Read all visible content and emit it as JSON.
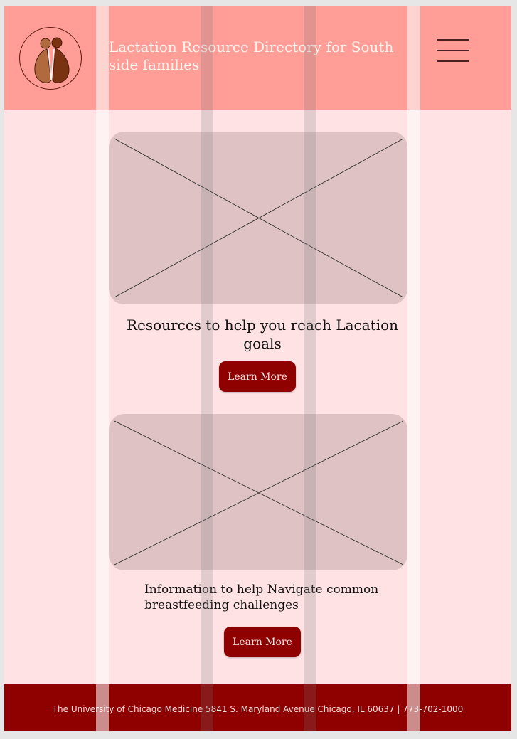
{
  "header": {
    "title": "Lactation Resource Directory for South side families",
    "logo_icon": "mother-and-baby-logo-icon",
    "menu_icon": "hamburger-menu-icon"
  },
  "cards": [
    {
      "image_icon": "image-placeholder-icon",
      "title": "Resources to help you reach Lacation goals",
      "button_label": "Learn More"
    },
    {
      "image_icon": "image-placeholder-icon",
      "title": "Information to help Navigate common breastfeeding challenges",
      "button_label": "Learn More"
    }
  ],
  "footer": {
    "text": "The University of Chicago Medicine 5841 S. Maryland Avenue Chicago, IL 60637 | 773-702-1000"
  },
  "colors": {
    "header_bg": "#ff9d96",
    "page_bg": "#ffe3e4",
    "accent": "#8f0101",
    "placeholder": "#dfc3c4"
  }
}
